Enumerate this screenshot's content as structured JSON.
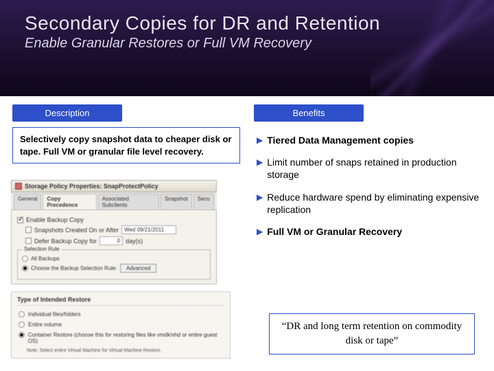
{
  "header": {
    "title": "Secondary Copies for DR and Retention",
    "subtitle": "Enable Granular Restores or Full VM Recovery"
  },
  "description": {
    "label": "Description",
    "text": "Selectively copy snapshot data to cheaper disk or tape. Full VM or granular file level recovery."
  },
  "benefits": {
    "label": "Benefits",
    "items": [
      "Tiered Data Management copies",
      "Limit number of snaps retained in production storage",
      "Reduce hardware spend by eliminating expensive replication",
      "Full VM or Granular Recovery"
    ],
    "bold_first_only": [
      true,
      false,
      false,
      true
    ]
  },
  "quote": "“DR and long term retention on commodity disk or tape”",
  "mock1": {
    "window_title": "Storage Policy Properties: SnapProtectPolicy",
    "tabs": [
      "General",
      "Copy Precedence",
      "Associated Subclients",
      "Snapshot",
      "Secu"
    ],
    "active_tab": "Copy Precedence",
    "enable_label": "Enable Backup Copy",
    "row1_chk": "Snapshots Created On or After",
    "row1_val": "Wed 09/21/2011",
    "row2_chk": "Defer Backup Copy for",
    "row2_val": "0",
    "row2_unit": "day(s)",
    "group_label": "Selection Rule",
    "radio1": "All Backups",
    "radio2": "Choose the Backup Selection Rule:",
    "adv_btn": "Advanced"
  },
  "mock2": {
    "title": "Type of Intended Restore",
    "opt1": "Individual files/folders",
    "opt2": "Entire volume",
    "opt3": "Container Restore (choose this for restoring files like vmdk/vhd or entire guest OS)",
    "note": "Note: Select entire Virtual Machine for Virtual Machine Restore."
  }
}
